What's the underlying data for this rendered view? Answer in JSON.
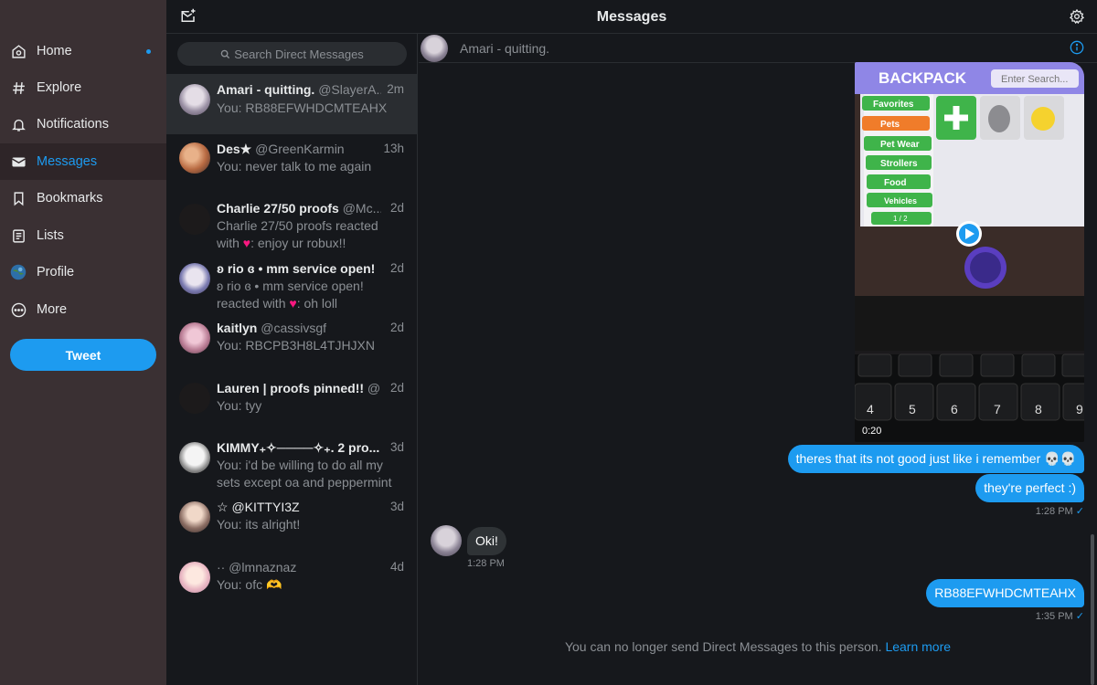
{
  "sidebar": {
    "items": [
      {
        "label": "Home",
        "icon": "home-icon"
      },
      {
        "label": "Explore",
        "icon": "hashtag-icon"
      },
      {
        "label": "Notifications",
        "icon": "bell-icon"
      },
      {
        "label": "Messages",
        "icon": "envelope-icon"
      },
      {
        "label": "Bookmarks",
        "icon": "bookmark-icon"
      },
      {
        "label": "Lists",
        "icon": "list-icon"
      },
      {
        "label": "Profile",
        "icon": "profile-avatar"
      },
      {
        "label": "More",
        "icon": "more-circle-icon"
      }
    ],
    "tweet_label": "Tweet"
  },
  "topbar": {
    "title": "Messages"
  },
  "search": {
    "placeholder": "Search Direct Messages"
  },
  "conversations": [
    {
      "name": "Amari - quitting.",
      "handle": "@SlayerA...",
      "time": "2m",
      "preview": "You: RB88EFWHDCMTEAHX"
    },
    {
      "name": "Des★",
      "handle": "@GreenKarmin",
      "time": "13h",
      "preview": "You: never talk to me again"
    },
    {
      "name": "Charlie 27/50 proofs",
      "handle": "@Mc...",
      "time": "2d",
      "preview_a": "Charlie 27/50 proofs reacted",
      "preview_b": "with",
      "preview_c": ": enjoy ur robux!!"
    },
    {
      "name": "ʚ rio ɞ • mm service open!",
      "handle": "",
      "time": "2d",
      "preview_a": "ʚ rio ɞ • mm service open!",
      "preview_b": "reacted with",
      "preview_c": ": oh loll"
    },
    {
      "name": "kaitlyn",
      "handle": "@cassivsgf",
      "time": "2d",
      "preview": "You: RBCPB3H8L4TJHJXN"
    },
    {
      "name": "Lauren | proofs pinned!!",
      "handle": "@...",
      "time": "2d",
      "preview": "You: tyy"
    },
    {
      "name": "KIMMY₊✧────✧₊. 2 pro...",
      "handle": "",
      "time": "3d",
      "preview": "You: i'd be willing to do all my sets except oa and peppermint"
    },
    {
      "name": "",
      "handle": "☆ @KITTYI3Z",
      "time": "3d",
      "preview": "You: its alright!"
    },
    {
      "name": "",
      "handle": "·· @lmnaznaz",
      "time": "4d",
      "preview": "You: ofc 🫶"
    }
  ],
  "chat": {
    "header_name": "Amari - quitting.",
    "video_duration": "0:20",
    "video_game": {
      "title": "BACKPACK",
      "search": "Enter Search...",
      "tabs": [
        "Favorites",
        "Pets",
        "Pet Wear",
        "Strollers",
        "Food",
        "Vehicles"
      ],
      "pager": "1 / 2"
    },
    "keyboard_keys": [
      "4",
      "5",
      "6",
      "7",
      "8",
      "9"
    ],
    "messages": [
      {
        "text": "theres that its not good just like i remember 💀💀",
        "dir": "out"
      },
      {
        "text": "they're perfect :)",
        "dir": "out",
        "time": "1:28 PM"
      },
      {
        "text": "Oki!",
        "dir": "in",
        "time": "1:28 PM"
      },
      {
        "text": "RB88EFWHDCMTEAHX",
        "dir": "out",
        "time": "1:35 PM"
      }
    ],
    "read_check": "✓",
    "notice": "You can no longer send Direct Messages to this person.",
    "learn_more": "Learn more"
  }
}
